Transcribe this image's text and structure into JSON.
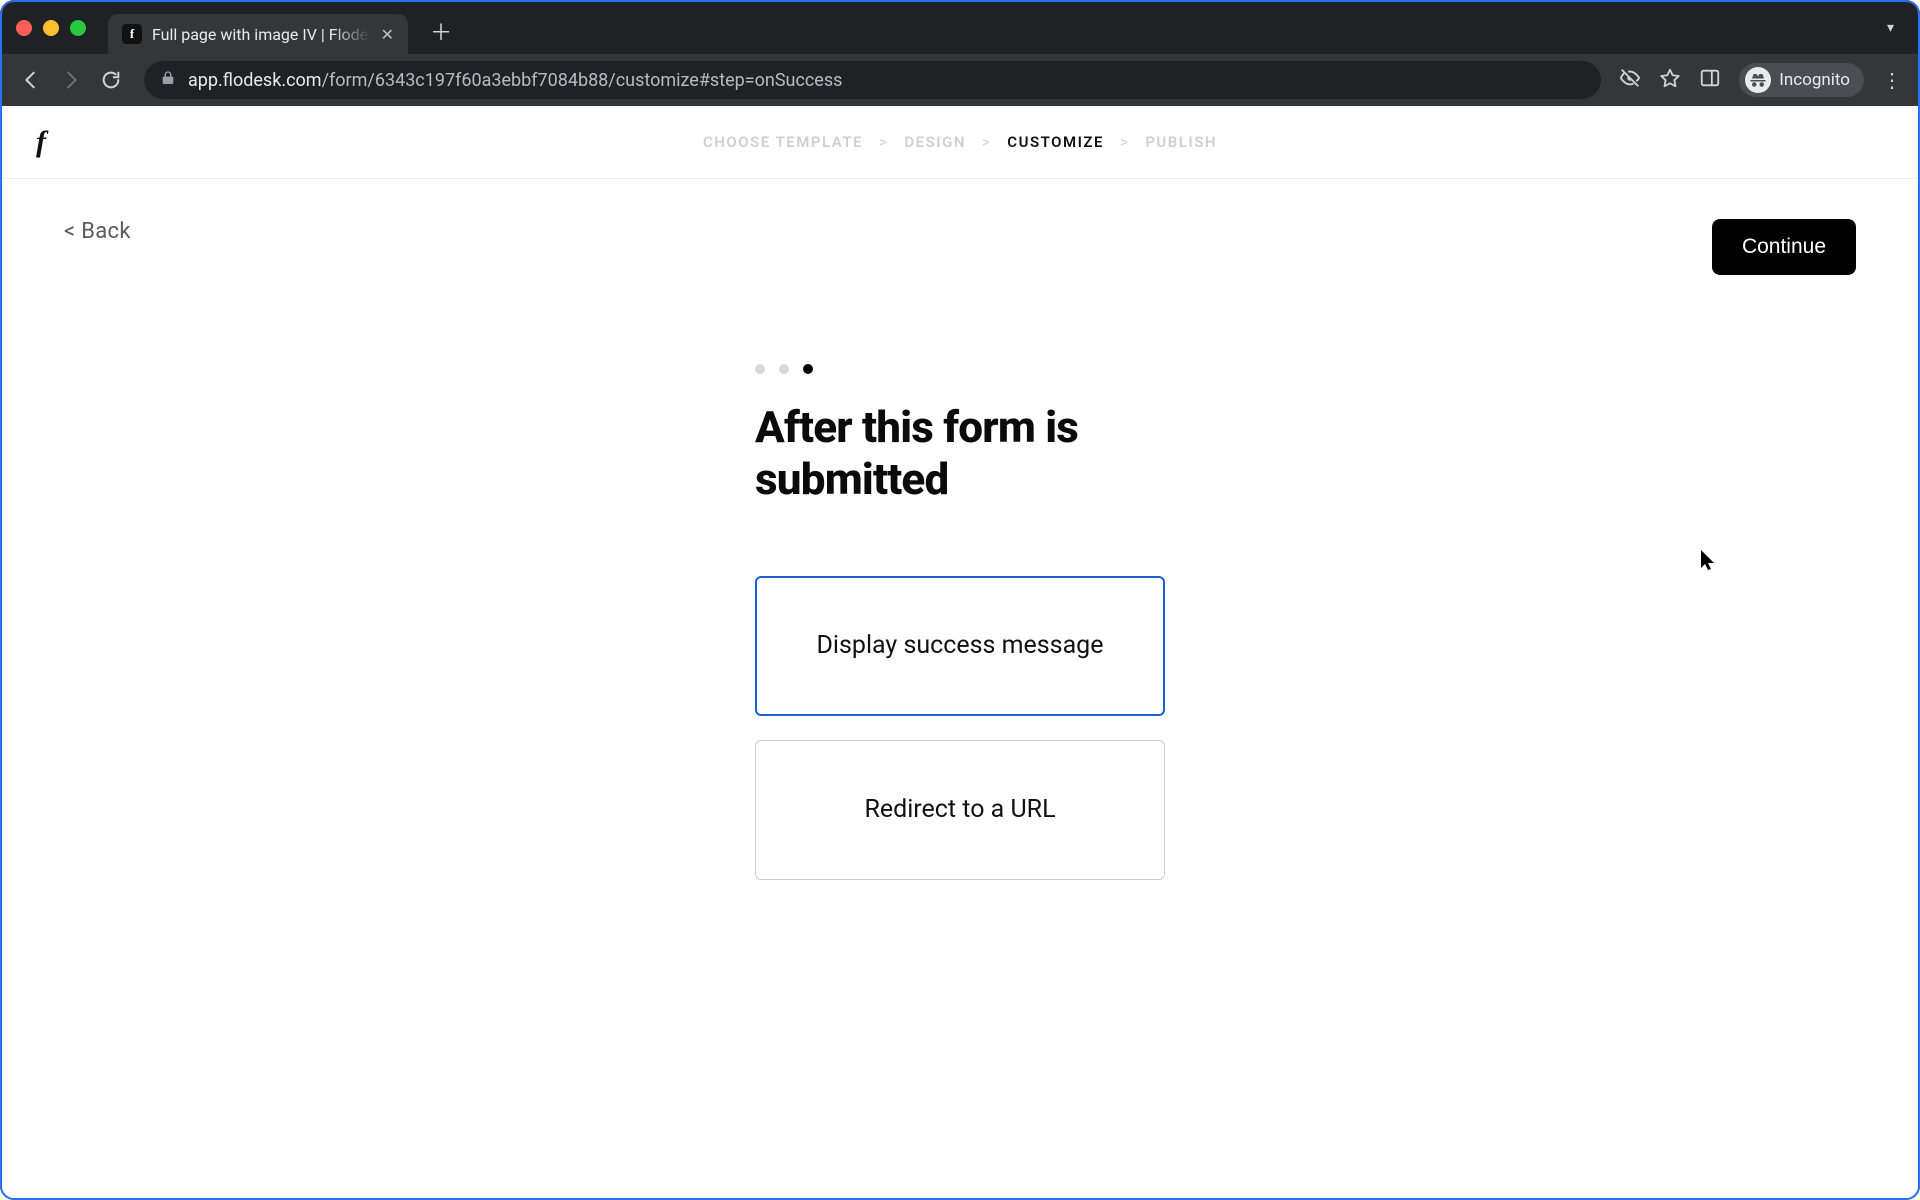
{
  "browser": {
    "tab_title": "Full page with image IV | Flode",
    "favicon_letter": "f",
    "url_host": "app.flodesk.com",
    "url_path": "/form/6343c197f60a3ebbf7084b88/customize#step=onSuccess",
    "incognito_label": "Incognito"
  },
  "header": {
    "brand_glyph": "f",
    "steps": [
      "CHOOSE TEMPLATE",
      "DESIGN",
      "CUSTOMIZE",
      "PUBLISH"
    ],
    "active_step_index": 2
  },
  "body": {
    "back_label": "< Back",
    "continue_label": "Continue",
    "progress": {
      "total": 3,
      "current_index": 2
    },
    "question_title": "After this form is submitted",
    "options": [
      {
        "label": "Display success message",
        "selected": true
      },
      {
        "label": "Redirect to a URL",
        "selected": false
      }
    ]
  }
}
